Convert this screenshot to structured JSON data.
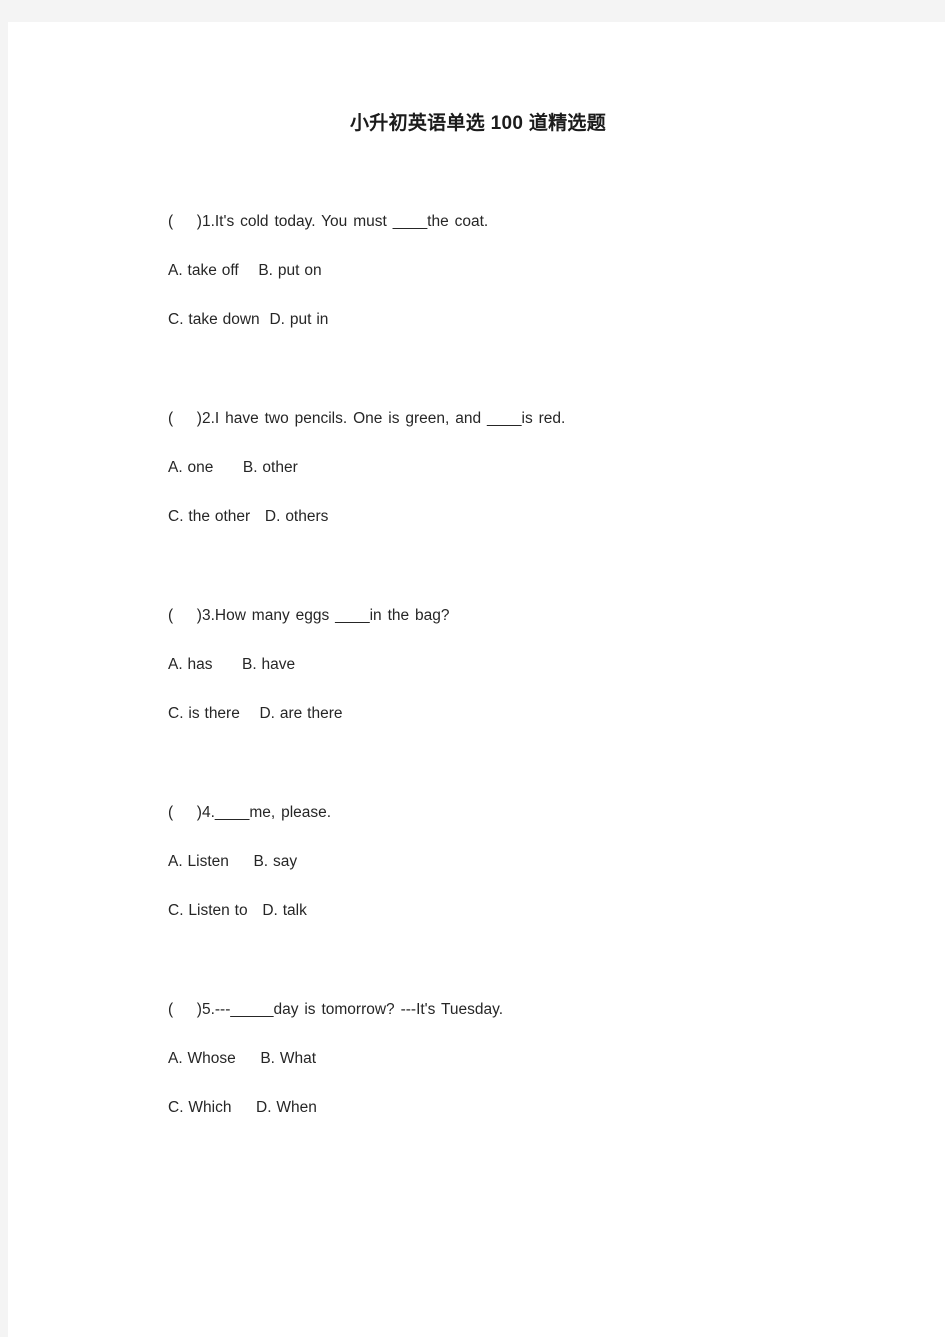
{
  "document": {
    "title": "小升初英语单选 100 道精选题",
    "page_background": "#ffffff",
    "canvas_background": "#f4f4f4",
    "text_color": "#262626",
    "title_color": "#1b1b1b"
  },
  "questions": [
    {
      "stem": "(    )1.It's cold today. You must ____the coat.",
      "options_line1": "A. take off    B. put on",
      "options_line2": "C. take down  D. put in"
    },
    {
      "stem": "(    )2.I have two pencils. One is green, and ____is red.",
      "options_line1": "A. one      B. other",
      "options_line2": "C. the other   D. others"
    },
    {
      "stem": "(    )3.How many eggs ____in the bag?",
      "options_line1": "A. has      B. have",
      "options_line2": "C. is there    D. are there"
    },
    {
      "stem": "(    )4.____me, please.",
      "options_line1": "A. Listen     B. say",
      "options_line2": "C. Listen to   D. talk"
    },
    {
      "stem": "(    )5.---_____day is tomorrow? ---It's Tuesday.",
      "options_line1": "A. Whose     B. What",
      "options_line2": "C. Which     D. When"
    }
  ]
}
